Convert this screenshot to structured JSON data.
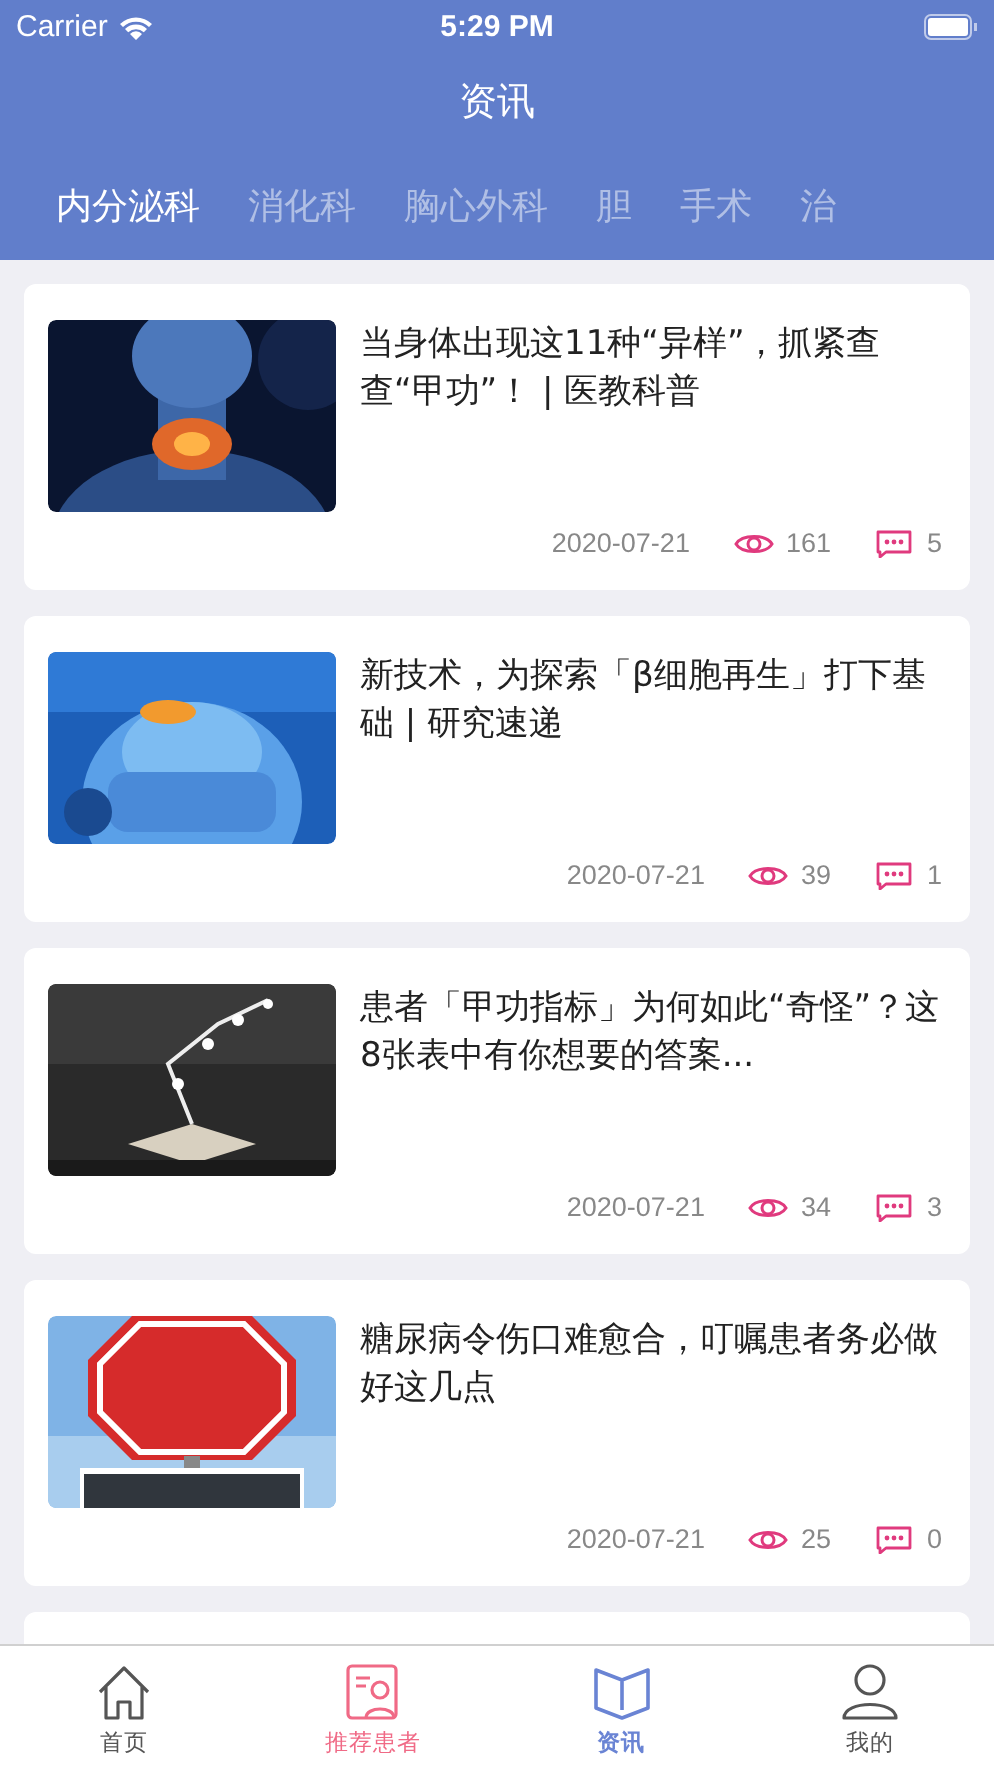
{
  "status_bar": {
    "carrier": "Carrier",
    "time": "5:29 PM"
  },
  "header": {
    "title": "资讯"
  },
  "categories": [
    {
      "label": "内分泌科",
      "selected": true
    },
    {
      "label": "消化科",
      "selected": false
    },
    {
      "label": "胸心外科",
      "selected": false
    },
    {
      "label": "胆",
      "selected": false
    },
    {
      "label": "手术",
      "selected": false
    },
    {
      "label": "治",
      "selected": false
    }
  ],
  "articles": [
    {
      "title": "当身体出现这11种“异样”，抓紧查查“甲功”！ | 医教科普",
      "date": "2020-07-21",
      "views": "161",
      "comments": "5"
    },
    {
      "title": "新技术，为探索「β细胞再生」打下基础 | 研究速递",
      "date": "2020-07-21",
      "views": "39",
      "comments": "1"
    },
    {
      "title": "患者「甲功指标」为何如此“奇怪”？这8张表中有你想要的答案...",
      "date": "2020-07-21",
      "views": "34",
      "comments": "3"
    },
    {
      "title": "糖尿病令伤口难愈合，叮嘱患者务必做好这几点",
      "date": "2020-07-21",
      "views": "25",
      "comments": "0"
    }
  ],
  "tab_bar": [
    {
      "label": "首页",
      "selected": false,
      "color": "#555555"
    },
    {
      "label": "推荐患者",
      "selected": false,
      "color": "#f06a86"
    },
    {
      "label": "资讯",
      "selected": true,
      "color": "#6a84d4"
    },
    {
      "label": "我的",
      "selected": false,
      "color": "#555555"
    }
  ]
}
